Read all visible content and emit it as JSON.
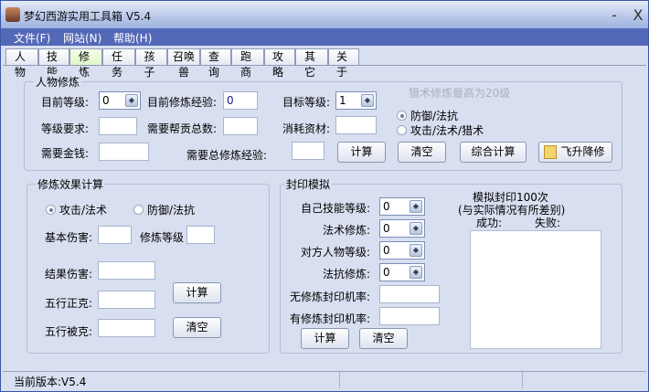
{
  "window": {
    "title": "梦幻西游实用工具箱 V5.4",
    "minimize": "-",
    "close": "X"
  },
  "menu": [
    "文件(F)",
    "网站(N)",
    "帮助(H)"
  ],
  "tabs": [
    "人 物",
    "技 能",
    "修 炼",
    "任 务",
    "孩 子",
    "召唤兽",
    "查 询",
    "跑 商",
    "攻 略",
    "其 它",
    "关 于"
  ],
  "selected_tab": "修 炼",
  "char": {
    "legend": "人物修炼",
    "cur_level_label": "目前等级:",
    "cur_level": "0",
    "cur_exp_label": "目前修炼经验:",
    "cur_exp": "0",
    "target_level_label": "目标等级:",
    "target_level": "1",
    "note": "猎术修炼最高为20级",
    "req_label": "等级要求:",
    "contrib_label": "需要帮贡总数:",
    "material_label": "消耗资材:",
    "radio1": "防御/法抗",
    "radio2": "攻击/法术/猎术",
    "money_label": "需要金钱:",
    "total_exp_label": "需要总修炼经验:",
    "calc": "计算",
    "clear": "清空",
    "combo": "综合计算",
    "fly": "飞升降修"
  },
  "effect": {
    "legend": "修炼效果计算",
    "radio1": "攻击/法术",
    "radio2": "防御/法抗",
    "base_label": "基本伤害:",
    "level_label": "修炼等级",
    "result_label": "结果伤害:",
    "wx_pos_label": "五行正克:",
    "wx_neg_label": "五行被克:",
    "calc": "计算",
    "clear": "清空"
  },
  "seal": {
    "legend": "封印模拟",
    "own_label": "自己技能等级:",
    "own": "0",
    "magic_label": "法术修炼:",
    "magic": "0",
    "enemy_label": "对方人物等级:",
    "enemy": "0",
    "resist_label": "法抗修炼:",
    "resist": "0",
    "no_rate_label": "无修炼封印机率:",
    "rate_label": "有修炼封印机率:",
    "calc": "计算",
    "clear": "清空",
    "sim_title": "模拟封印100次",
    "sim_note": "(与实际情况有所差别)",
    "success": "成功:",
    "fail": "失败:"
  },
  "status": {
    "version": "当前版本:V5.4"
  }
}
